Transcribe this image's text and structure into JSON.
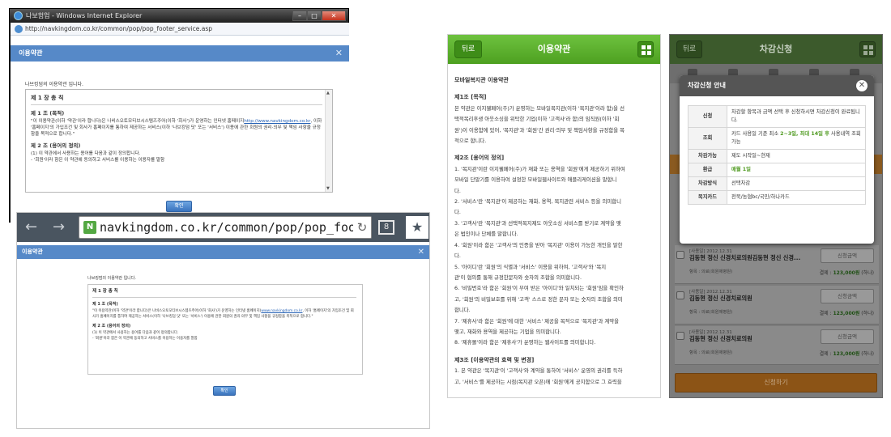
{
  "ie_popup": {
    "window_title": "나보험업 - Windows Internet Explorer",
    "address": "http://navkingdom.co.kr/common/pop/pop_footer_service.asp",
    "modal_title": "이용약관",
    "intro": "나브킹덤의 이용약관 입니다.",
    "chapter": "제 1 장 총 칙",
    "article1_title": "제 1 조 (목적)",
    "article1_text_a": "\"이 이용약관(이하 '약관'이라 합니다)은 나비스오토모티브시스템즈주어(이하 '회사')가 운영하는 인터넷 홈페이지",
    "article1_link": "http://www.navkingdom.co.kr",
    "article1_text_b": ", 이하 '홈페이지'의 가입조건 및 회사가 홈페이지를 통하여 제공하는 서비스(이하 '나브킹덤 닷' 또는 '서비스') 이용에 관한 회원의 권리·의무 및 책임 사항을 규정함을 목적으로 합니다.\"",
    "article2_title": "제 2 조 (용어의 정의)",
    "article2_text": "(1) 이 약관에서 사용하는 용어를 다음과 같이 정의합니다.",
    "article2_item": "- '회원'이라 함은 이 약관에 동의하고 서비스를 이용하는 이용자를 말함",
    "confirm_label": "확인"
  },
  "mobile_browser": {
    "url": "navkingdom.co.kr/common/pop/pop_footer_ser",
    "tab_count": "8",
    "modal_title": "이용약관",
    "intro": "나브킹덤의 이용약관 입니다.",
    "chapter": "제 1 장 총 칙",
    "article1_title": "제 1 조 (목적)",
    "article1_text_a": "\"이 이용약관(이하 '약관'이라 합니다)은 나비스오토모티브시스템즈주어(이하 '회사')가 운영하는 인터넷 홈페이지(",
    "article1_link": "www.navkingdom.co.kr",
    "article1_text_b": ", 이하 '홈페이지'의 가입조건 및 회사가 홈페이지를 통하여 제공하는 서비스(이하 '나브킹덤 닷' 또는 '서비스') 이용에 관한 회원의 권리·의무 및 책임 사항을 규정함을 목적으로 합니다.\"",
    "article2_title": "제 2 조 (용어의 정의)",
    "article2_text": "(1) 이 약관에서 사용하는 용어를 다음과 같이 정의합니다.",
    "article2_item": "- '회원'이라 함은 이 약관에 동의하고 서비스를 이용하는 이용자를 말함",
    "confirm_label": "확인"
  },
  "mobile_terms": {
    "back_label": "뒤로",
    "title": "이용약관",
    "heading": "모바일복지관 이용약관",
    "art1_title": "제1조 [목적]",
    "art1_lines": [
      "본 약관은 이지웰페어(주)가 운영하는 모바일복지관(이하 '복지관'이라 함)을 선",
      "택적복리후생 아웃소싱을 위탁한 기업(이하 '고객사'라 함)의 임직원(이하 '회",
      "원')이 이용함에 있어, '복지관'과 '회원'간 권리·의무 및 책임사항을 규정함을 목",
      "적으로 합니다."
    ],
    "art2_title": "제2조 [용어의 정의]",
    "art2_lines": [
      "1. '복지관'이란 이지웰페어(주)가 재화 또는 용역을 '회원'에게 제공하기 위하여",
      "모바일 단말기를 이용하여 설정한 모바일웹사이트와 애플리케이션을 말합니",
      "다.",
      "2. '서비스'란 '복지관'이 제공하는 재화, 용역, 복지관련 서비스 등을 의미합니",
      "다.",
      "3. '고객사'란 '복지관'과 선택적복지제도 아웃소싱 서비스를 받기로 계약을 맺",
      "은 법인이나 단체를 말합니다.",
      "4. '회원'이라 함은 '고객사'의 인증을 받아 '복지관' 이용이 가능한 개인을 말한",
      "다.",
      "5. '아이디'란 '회원'의 식별과 '서비스' 이용을 위하여, '고객사'와 '복지",
      "관'이 협의를 통해 규정한문자와 숫자의 조합을 의미합니다.",
      "6. '비밀번호'라 함은 '회원'이 부여 받은 '아이디'와 일치되는 '회원'임을 확인하",
      "고, '회원'의 비밀보호를 위해 '고객' 스스로 정한 문자 또는 숫자의 조합을 의미",
      "합니다.",
      "7. '제휴사'라 함은 '회원'에 대한 '서비스' 제공을 목적으로 '복지관'과 계약을",
      "맺고, 재화와 용역을 제공하는 기업을 의미합니다.",
      "8. '제휴몰'이라 함은 '제휴사'가 운영하는 웹사이트를 의미합니다."
    ],
    "art3_title": "제3조 [이용약관의 효력 및 변경]",
    "art3_lines": [
      "1. 본 약관은 '복지관'이 '고객사'와 계약을 통하여 '서비스' 운영의 권리를 득하",
      "고, '서비스'를 제공하는 시점(복지관 오픈)에 '회원'에게 공지함으로 그 효력을"
    ]
  },
  "discount": {
    "back_label": "뒤로",
    "title": "차감신청",
    "dialog_title": "차감신청 안내",
    "rows": [
      {
        "key": "신청",
        "value": "차감할 항목과 금액 선택 후 신청하시면 차감신청이 완료됩니다."
      },
      {
        "key": "조회",
        "value_a": "카드 사용일 기준 최소 ",
        "value_hl": "2~3일, 최대 14일 후",
        "value_b": " 사용내역 조회 가능"
      },
      {
        "key": "차감가능",
        "value": "제도 시작일~현재"
      },
      {
        "key": "환급",
        "value": "매월 1일"
      },
      {
        "key": "차감방식",
        "value": "선택차감"
      },
      {
        "key": "복지카드",
        "value": "전북/농협bc/국민/하나카드"
      }
    ],
    "items": [
      {
        "tag": "[사용일] 2012.12.31",
        "name": "김동현 정신 신경치료의원김동현 정신 신경...",
        "hosp": "항목 : 의료(회원제병원)",
        "amount_btn": "신청금액",
        "pay_label": "결제 : ",
        "pay_value": "123,000원",
        "pay_suffix": " (하나)"
      },
      {
        "tag": "[사용일] 2012.12.31",
        "name": "김동현 정신 신경치료의원",
        "hosp": "항목 : 의료(회원제병원)",
        "amount_btn": "신청금액",
        "pay_label": "결제 : ",
        "pay_value": "123,000원",
        "pay_suffix": " (하나)"
      },
      {
        "tag": "[사용일] 2012.12.31",
        "name": "김동현 정신 신경치료의원",
        "hosp": "항목 : 의료(회원제병원)",
        "amount_btn": "신청금액",
        "pay_label": "결제 : ",
        "pay_value": "123,000원",
        "pay_suffix": " (하나)"
      }
    ],
    "submit_label": "신청하기"
  }
}
